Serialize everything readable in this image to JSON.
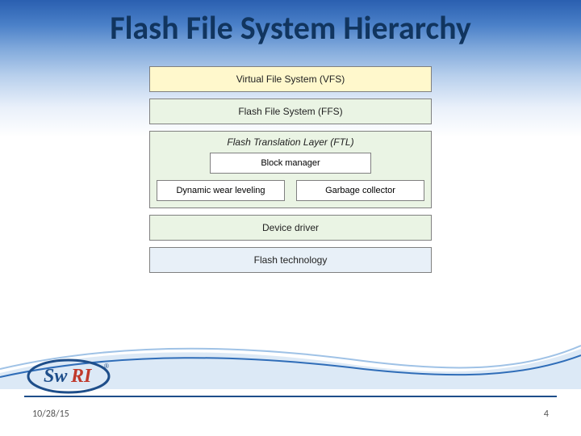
{
  "title": "Flash File System Hierarchy",
  "boxes": {
    "vfs": "Virtual File System (VFS)",
    "ffs": "Flash File System (FFS)",
    "ftl_title": "Flash Translation Layer (FTL)",
    "block_manager": "Block manager",
    "dynamic_wear": "Dynamic wear leveling",
    "garbage": "Garbage collector",
    "driver": "Device driver",
    "tech": "Flash technology"
  },
  "footer": {
    "date": "10/28/15",
    "page": "4"
  },
  "logo_text": {
    "sw": "Sw",
    "ri": "RI"
  }
}
